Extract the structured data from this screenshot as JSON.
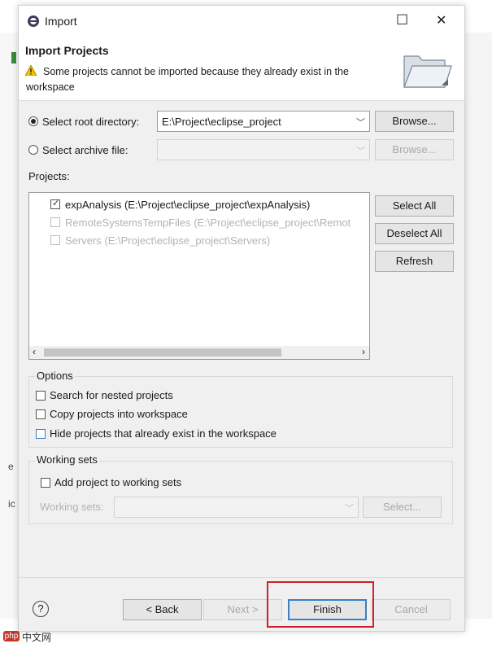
{
  "window": {
    "title": "Import",
    "minimize_glyph": "☐",
    "close_glyph": "✕"
  },
  "banner": {
    "heading": "Import Projects",
    "warning": "Some projects cannot be imported because they already exist in the",
    "warning_line2": "workspace",
    "icon": "folder-wizard-icon"
  },
  "source": {
    "root_label": "Select root directory:",
    "root_value": "E:\\Project\\eclipse_project",
    "archive_label": "Select archive file:",
    "archive_value": "",
    "browse_label": "Browse...",
    "selected": "root"
  },
  "projects": {
    "label": "Projects:",
    "items": [
      {
        "label": "expAnalysis (E:\\Project\\eclipse_project\\expAnalysis)",
        "checked": true,
        "enabled": true
      },
      {
        "label": "RemoteSystemsTempFiles (E:\\Project\\eclipse_project\\Remot",
        "checked": false,
        "enabled": false
      },
      {
        "label": "Servers (E:\\Project\\eclipse_project\\Servers)",
        "checked": false,
        "enabled": false
      }
    ],
    "select_all": "Select All",
    "deselect_all": "Deselect All",
    "refresh": "Refresh"
  },
  "options": {
    "title": "Options",
    "search_nested": "Search for nested projects",
    "copy_into": "Copy projects into workspace",
    "hide_existing": "Hide projects that already exist in the workspace"
  },
  "working_sets": {
    "title": "Working sets",
    "add_label": "Add project to working sets",
    "sets_label": "Working sets:",
    "select_btn": "Select..."
  },
  "footer": {
    "help": "?",
    "back": "< Back",
    "next": "Next >",
    "finish": "Finish",
    "cancel": "Cancel",
    "highlight_color": "#d0202a"
  },
  "watermark": {
    "badge": "php",
    "text": "中文网"
  }
}
